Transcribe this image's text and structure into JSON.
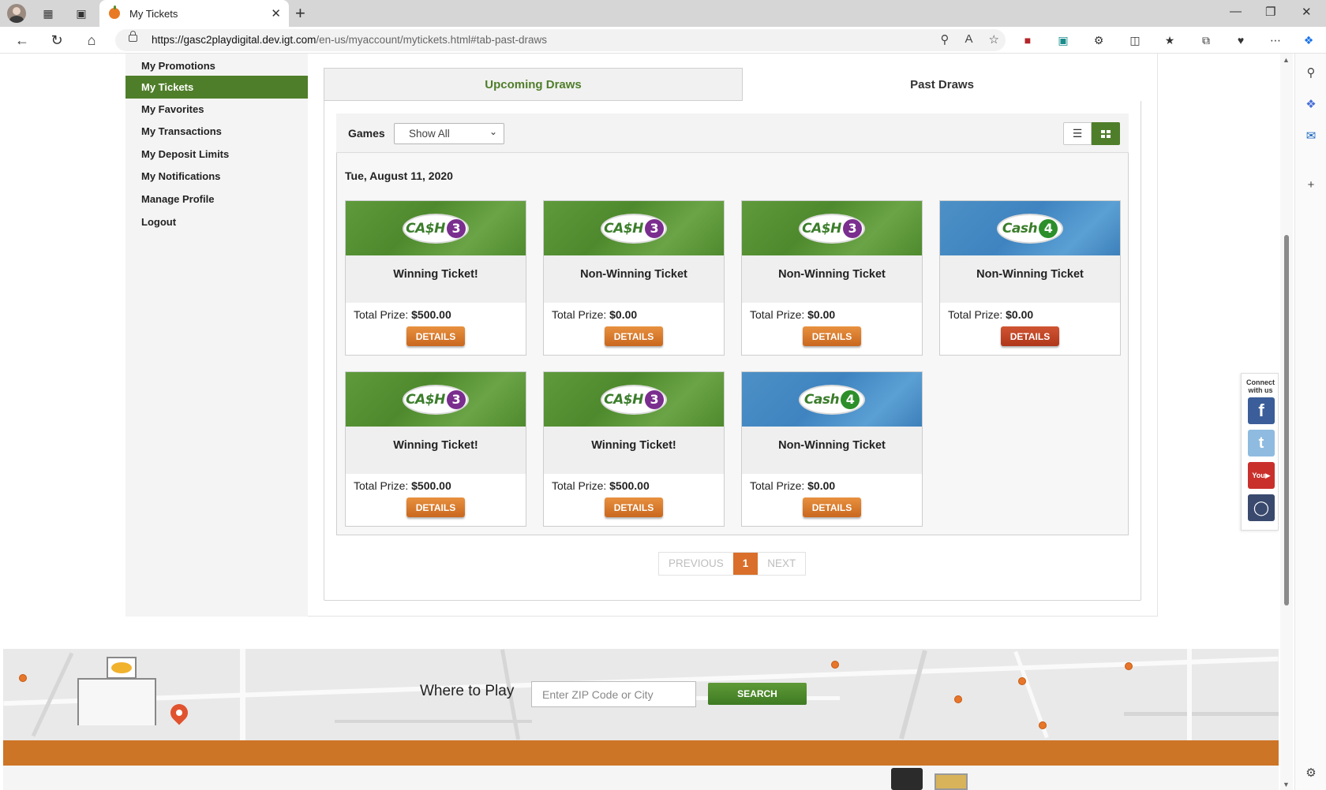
{
  "browser": {
    "tab_title": "My Tickets",
    "url_host": "https://gasc2playdigital.dev.igt.com",
    "url_path": "/en-us/myaccount/mytickets.html#tab-past-draws"
  },
  "sidebar": {
    "items": [
      {
        "label": "My Promotions"
      },
      {
        "label": "My Tickets"
      },
      {
        "label": "My Favorites"
      },
      {
        "label": "My Transactions"
      },
      {
        "label": "My Deposit Limits"
      },
      {
        "label": "My Notifications"
      },
      {
        "label": "Manage Profile"
      },
      {
        "label": "Logout"
      }
    ],
    "active_index": 1
  },
  "draw_tabs": {
    "upcoming": "Upcoming Draws",
    "past": "Past Draws",
    "active": "past"
  },
  "filters": {
    "games_label": "Games",
    "games_selected": "Show All"
  },
  "draw_date": "Tue, August 11, 2020",
  "tickets": [
    {
      "game": "CA$H 3",
      "logo_word": "CA$H",
      "logo_num": "3",
      "status": "Winning Ticket!",
      "prize_label": "Total Prize:",
      "prize": "$500.00",
      "button": "DETAILS",
      "theme": "green"
    },
    {
      "game": "CA$H 3",
      "logo_word": "CA$H",
      "logo_num": "3",
      "status": "Non-Winning Ticket",
      "prize_label": "Total Prize:",
      "prize": "$0.00",
      "button": "DETAILS",
      "theme": "green"
    },
    {
      "game": "CA$H 3",
      "logo_word": "CA$H",
      "logo_num": "3",
      "status": "Non-Winning Ticket",
      "prize_label": "Total Prize:",
      "prize": "$0.00",
      "button": "DETAILS",
      "theme": "green"
    },
    {
      "game": "Cash 4",
      "logo_word": "Cash",
      "logo_num": "4",
      "status": "Non-Winning Ticket",
      "prize_label": "Total Prize:",
      "prize": "$0.00",
      "button": "DETAILS",
      "theme": "blue"
    },
    {
      "game": "CA$H 3",
      "logo_word": "CA$H",
      "logo_num": "3",
      "status": "Winning Ticket!",
      "prize_label": "Total Prize:",
      "prize": "$500.00",
      "button": "DETAILS",
      "theme": "green"
    },
    {
      "game": "CA$H 3",
      "logo_word": "CA$H",
      "logo_num": "3",
      "status": "Winning Ticket!",
      "prize_label": "Total Prize:",
      "prize": "$500.00",
      "button": "DETAILS",
      "theme": "green"
    },
    {
      "game": "Cash 4",
      "logo_word": "Cash",
      "logo_num": "4",
      "status": "Non-Winning Ticket",
      "prize_label": "Total Prize:",
      "prize": "$0.00",
      "button": "DETAILS",
      "theme": "blue"
    }
  ],
  "pagination": {
    "previous": "PREVIOUS",
    "current": "1",
    "next": "NEXT"
  },
  "social": {
    "label_line1": "Connect",
    "label_line2": "with us",
    "networks": [
      "facebook",
      "twitter",
      "youtube",
      "instagram"
    ]
  },
  "where_to_play": {
    "title": "Where to Play",
    "zip_placeholder": "Enter ZIP Code or City",
    "search_label": "SEARCH"
  },
  "colors": {
    "brand_green": "#4f7e2a",
    "brand_orange": "#cd7526",
    "details_orange": "#d97a2c",
    "details_red": "#c0401f"
  }
}
